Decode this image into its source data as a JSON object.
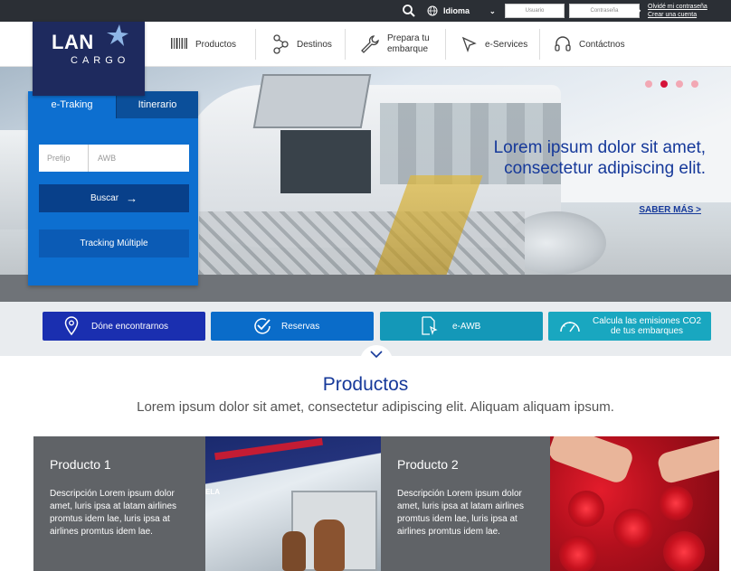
{
  "topbar": {
    "idioma": "Idioma",
    "usuario_placeholder": "Usuario",
    "contrasena_placeholder": "Contraseña",
    "forgot_link": "Olvidé mi contraseña",
    "create_link": "Crear una cuenta"
  },
  "logo": {
    "lan": "LAN",
    "cargo": "CARGO"
  },
  "nav": [
    {
      "label": "Productos",
      "icon": "barcode-icon"
    },
    {
      "label": "Destinos",
      "icon": "network-nodes-icon"
    },
    {
      "label": "Prepara tu embarque",
      "icon": "wrench-icon"
    },
    {
      "label": "e-Services",
      "icon": "cursor-arrow-icon"
    },
    {
      "label": "Contáctnos",
      "icon": "headset-icon"
    }
  ],
  "hero": {
    "headline": "Lorem ipsum dolor sit amet, consectetur adipiscing elit.",
    "saber_mas": "SABER MÁS >",
    "carousel_active_index": 1,
    "carousel_count": 4
  },
  "tracking": {
    "tab_tracking": "e-Traking",
    "tab_itinerario": "Itinerario",
    "prefijo_placeholder": "Prefijo",
    "awb_placeholder": "AWB",
    "buscar": "Buscar",
    "multiple": "Tracking Múltiple"
  },
  "quick": [
    {
      "label": "Dóne encontrarnos",
      "icon": "location-pin-icon"
    },
    {
      "label": "Reservas",
      "icon": "check-circle-icon"
    },
    {
      "label": "e-AWB",
      "icon": "document-cursor-icon"
    },
    {
      "label": "Calcula las emisiones CO2 de tus embarques",
      "icon": "gauge-icon"
    }
  ],
  "productos": {
    "title": "Productos",
    "subtitle": "Lorem ipsum dolor sit amet, consectetur adipiscing elit. Aliquam aliquam ipsum.",
    "items": [
      {
        "title": "Producto 1",
        "desc": "Descripción Lorem ipsum dolor amet, luris ipsa at latam airlines promtus idem lae, luris ipsa at airlines promtus idem lae."
      },
      {
        "title": "Producto 2",
        "desc": "Descripción Lorem ipsum dolor amet, luris ipsa at latam airlines promtus idem lae, luris ipsa at airlines promtus idem lae."
      }
    ],
    "photo1_text": "ELA"
  },
  "colors": {
    "brand_navy": "#1e2a5e",
    "brand_blue": "#16399a",
    "accent_red": "#d5143a"
  }
}
